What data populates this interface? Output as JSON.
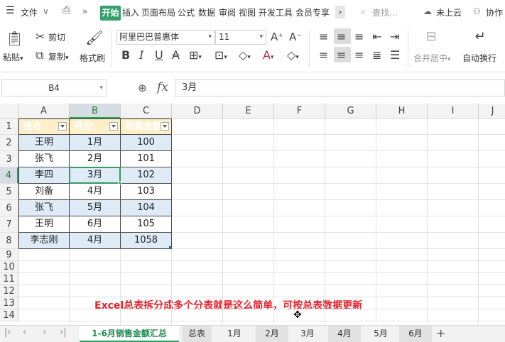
{
  "menu": {
    "hamburger_icon": "menu-icon",
    "file_label": "文件",
    "chevron": "∨",
    "more": "»",
    "tabs": [
      "开始",
      "插入",
      "页面布局",
      "公式",
      "数据",
      "审阅",
      "视图",
      "开发工具",
      "会员专享"
    ],
    "active_tab": "开始",
    "search_placeholder": "查找...",
    "cloud_label": "未上云",
    "collab_label": "协作"
  },
  "toolbar": {
    "paste_label": "粘贴",
    "cut_label": "剪切",
    "copy_label": "复制",
    "format_painter_label": "格式刷",
    "font_name": "阿里巴巴普惠体",
    "font_size": "11",
    "merge_center_label": "合并居中",
    "wrap_text_label": "自动换行"
  },
  "formula_bar": {
    "name_box": "B4",
    "fx_label": "fx",
    "content": "3月"
  },
  "grid": {
    "columns": [
      "A",
      "B",
      "C",
      "D",
      "E",
      "F",
      "G",
      "H",
      "I",
      "J"
    ],
    "selected_column": "B",
    "rows": [
      "1",
      "2",
      "3",
      "4",
      "5",
      "6",
      "7",
      "8",
      "9",
      "10",
      "11",
      "12",
      "13",
      "14"
    ],
    "selected_row": "4",
    "header_row": [
      "姓名",
      "月份",
      "销售金额"
    ],
    "data": [
      [
        "王明",
        "1月",
        "100"
      ],
      [
        "张飞",
        "2月",
        "101"
      ],
      [
        "李四",
        "3月",
        "102"
      ],
      [
        "刘备",
        "4月",
        "103"
      ],
      [
        "张飞",
        "5月",
        "104"
      ],
      [
        "王明",
        "6月",
        "105"
      ],
      [
        "李志刚",
        "4月",
        "1058"
      ]
    ],
    "active_cell": "B4"
  },
  "caption": "Excel总表拆分成多个分表就是这么简单，可按总表数据更新",
  "sheets": {
    "tabs": [
      "1-6月销售金额汇总",
      "总表",
      "1月",
      "2月",
      "3月",
      "4月",
      "5月",
      "6月"
    ],
    "active": "1-6月销售金额汇总",
    "add_label": "+"
  },
  "colors": {
    "accent": "#2e9e5c",
    "header_fill": "#fdf0c8",
    "band_fill": "#deeaf6",
    "caption": "#e8202a"
  }
}
